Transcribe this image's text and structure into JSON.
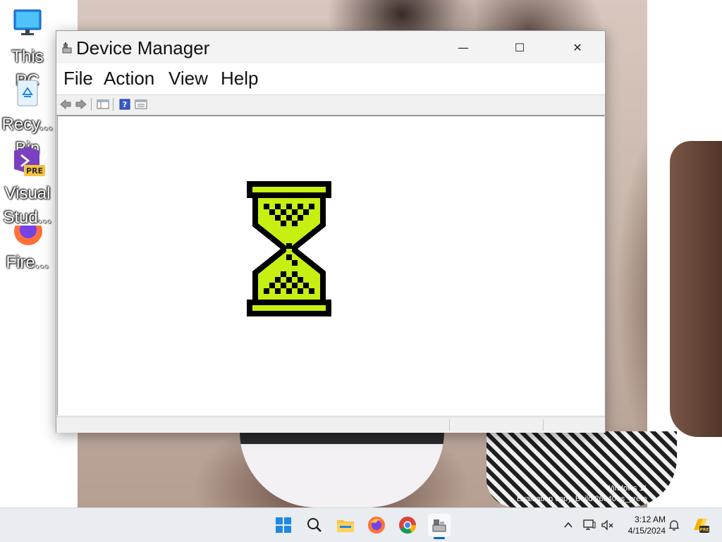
{
  "desktop": {
    "icons": [
      {
        "name": "this-pc",
        "label": "This PC"
      },
      {
        "name": "recycle-bin",
        "label": "Recy... Bin"
      },
      {
        "name": "visual-studio",
        "label": "Visual Stud..."
      },
      {
        "name": "firefox",
        "label": "Fire..."
      }
    ],
    "watermark": {
      "line1": "Windows 11",
      "line2": "Evaluation copy. Build 26040.rs_prere"
    }
  },
  "window": {
    "title": "Device Manager",
    "controls": {
      "minimize": "—",
      "maximize": "☐",
      "close": "✕"
    },
    "menu": [
      "File",
      "Action",
      "View",
      "Help"
    ],
    "toolbar": [
      "back-icon",
      "forward-icon",
      "show-hide-console-tree-icon",
      "help-icon",
      "properties-icon"
    ]
  },
  "taskbar": {
    "apps": [
      "start-icon",
      "search-icon",
      "file-explorer-icon",
      "firefox-icon",
      "chrome-icon",
      "device-manager-icon"
    ],
    "tray": [
      "chevron-up-icon",
      "network-icon",
      "volume-muted-icon",
      "notification-bell-icon"
    ],
    "time": "3:12 AM",
    "date": "4/15/2024"
  },
  "colors": {
    "hourglass_fill": "#c6ef12",
    "accent": "#0067c0"
  }
}
